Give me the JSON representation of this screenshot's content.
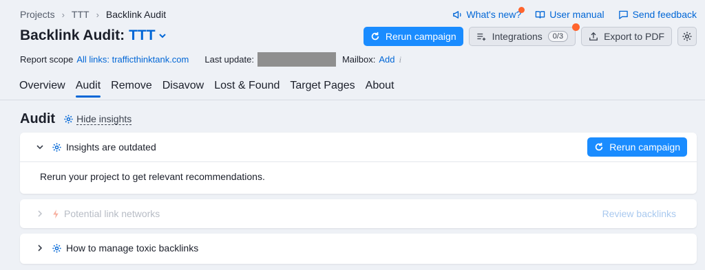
{
  "breadcrumb": [
    "Projects",
    "TTT",
    "Backlink Audit"
  ],
  "top_links": {
    "whats_new": "What's new?",
    "user_manual": "User manual",
    "send_feedback": "Send feedback"
  },
  "title": {
    "prefix": "Backlink Audit:",
    "project": "TTT"
  },
  "actions": {
    "rerun": "Rerun campaign",
    "integrations": "Integrations",
    "integrations_count": "0/3",
    "export": "Export to PDF"
  },
  "scope": {
    "report_scope_label": "Report scope",
    "report_scope_link": "All links: trafficthinktank.com",
    "last_update_label": "Last update:",
    "mailbox_label": "Mailbox:",
    "mailbox_link": "Add",
    "info": "i"
  },
  "tabs": [
    "Overview",
    "Audit",
    "Remove",
    "Disavow",
    "Lost & Found",
    "Target Pages",
    "About"
  ],
  "active_tab": "Audit",
  "section": {
    "title": "Audit",
    "hide_insights": "Hide insights"
  },
  "cards": {
    "outdated": {
      "title": "Insights are outdated",
      "button": "Rerun campaign",
      "body": "Rerun your project to get relevant recommendations."
    },
    "networks": {
      "title": "Potential link networks",
      "link": "Review backlinks"
    },
    "toxic": {
      "title": "How to manage toxic backlinks"
    }
  },
  "colors": {
    "accent": "#0066d6",
    "primary_button": "#1a8cff",
    "notification": "#ff642d",
    "background": "#eef1f6"
  }
}
